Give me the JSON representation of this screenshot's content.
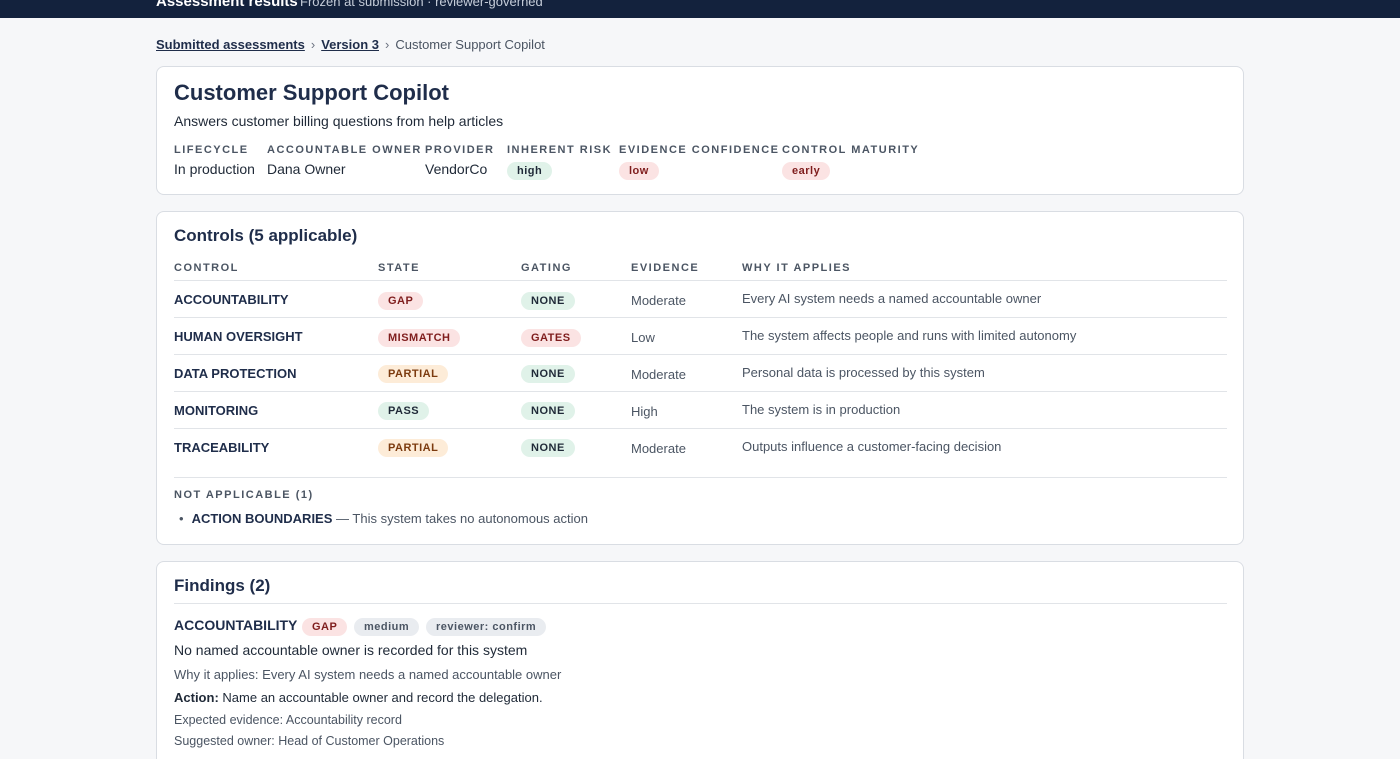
{
  "topbar": {
    "title": "Assessment results",
    "subtitle": "Frozen at submission · reviewer-governed"
  },
  "breadcrumb": {
    "item1": "Submitted assessments",
    "item2": "Version 3",
    "current": "Customer Support Copilot",
    "sep": "›"
  },
  "system": {
    "name": "Customer Support Copilot",
    "description": "Answers customer billing questions from help articles",
    "fields": {
      "lifecycle": {
        "label": "LIFECYCLE",
        "value": "In production"
      },
      "owner": {
        "label": "ACCOUNTABLE OWNER",
        "value": "Dana Owner"
      },
      "provider": {
        "label": "PROVIDER",
        "value": "VendorCo"
      },
      "risk": {
        "label": "INHERENT RISK",
        "value": "high",
        "color": "#e0f2e9"
      },
      "confidence": {
        "label": "EVIDENCE CONFIDENCE",
        "value": "low",
        "color": "#fbe3e3"
      },
      "maturity": {
        "label": "CONTROL MATURITY",
        "value": "early",
        "color": "#fbe3e3"
      }
    }
  },
  "controls": {
    "title": "Controls (5 applicable)",
    "headers": {
      "control": "CONTROL",
      "state": "STATE",
      "gating": "GATING",
      "evidence": "EVIDENCE",
      "why": "WHY IT APPLIES"
    },
    "rows": [
      {
        "control": "ACCOUNTABILITY",
        "state": "GAP",
        "gating": "NONE",
        "evidence": "Moderate",
        "why": "Every AI system needs a named accountable owner"
      },
      {
        "control": "HUMAN OVERSIGHT",
        "state": "MISMATCH",
        "gating": "GATES",
        "evidence": "Low",
        "why": "The system affects people and runs with limited autonomy"
      },
      {
        "control": "DATA PROTECTION",
        "state": "PARTIAL",
        "gating": "NONE",
        "evidence": "Moderate",
        "why": "Personal data is processed by this system"
      },
      {
        "control": "MONITORING",
        "state": "PASS",
        "gating": "NONE",
        "evidence": "High",
        "why": "The system is in production"
      },
      {
        "control": "TRACEABILITY",
        "state": "PARTIAL",
        "gating": "NONE",
        "evidence": "Moderate",
        "why": "Outputs influence a customer-facing decision"
      }
    ],
    "not_applicable": {
      "title": "NOT APPLICABLE (1)",
      "items": [
        {
          "control": "ACTION BOUNDARIES",
          "reason": "— This system takes no autonomous action"
        }
      ]
    }
  },
  "findings": {
    "title": "Findings (2)",
    "items": [
      {
        "control": "ACCOUNTABILITY",
        "state": "GAP",
        "severity": "medium",
        "reviewer": "reviewer: confirm",
        "summary": "No named accountable owner is recorded for this system",
        "why": "Why it applies: Every AI system needs a named accountable owner",
        "action_label": "Action:",
        "action": "Name an accountable owner and record the delegation.",
        "expected": "Expected evidence: Accountability record",
        "owner": "Suggested owner: Head of Customer Operations"
      }
    ]
  },
  "colors": {
    "topbar": "#13223d",
    "heading": "#1f2d4a",
    "green_pill": "#e0f2e9",
    "red_pill": "#fbe3e3",
    "orange_pill": "#fdecd8",
    "gray_pill": "#e9ecf0"
  }
}
